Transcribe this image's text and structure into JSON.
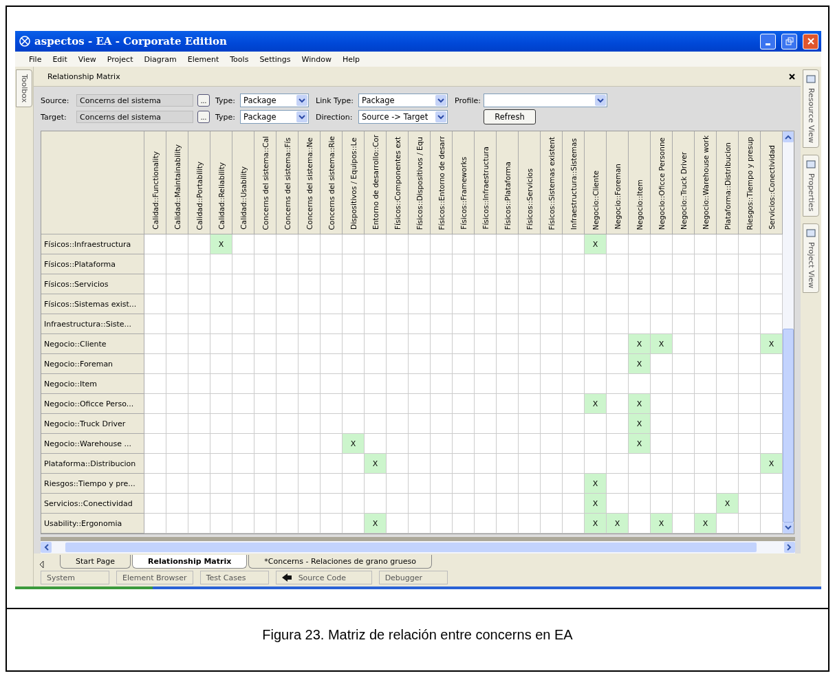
{
  "window": {
    "title": "aspectos - EA - Corporate Edition"
  },
  "menu": [
    "File",
    "Edit",
    "View",
    "Project",
    "Diagram",
    "Element",
    "Tools",
    "Settings",
    "Window",
    "Help"
  ],
  "left_tabs": [
    "Toolbox"
  ],
  "right_tabs": [
    "Resource View",
    "Properties",
    "Project View"
  ],
  "panel": {
    "title": "Relationship Matrix"
  },
  "filters": {
    "source_label": "Source:",
    "source": "Concerns del sistema",
    "target_label": "Target:",
    "target": "Concerns del sistema",
    "browse": "...",
    "source_type_label": "Type:",
    "target_type_label": "Type:",
    "source_type": "Package",
    "target_type": "Package",
    "link_type_label": "Link Type:",
    "link_type": "Package",
    "direction_label": "Direction:",
    "direction": "Source -> Target",
    "profile_label": "Profile:",
    "refresh": "Refresh"
  },
  "matrix": {
    "columns": [
      "Calidad::Functionality",
      "Calidad::Maintainability",
      "Calidad::Portability",
      "Calidad::Reliability",
      "Calidad::Usability",
      "Concerns del sistema::Cal",
      "Concerns del sistema::Fís",
      "Concerns del sistema::Ne",
      "Concerns del sistema::Rie",
      "Dispositivos / Equipos::Le",
      "Entorno de desarrollo::Cor",
      "Físicos::Componentes ext",
      "Físicos::Dispositivos / Equ",
      "Físicos::Entorno de desarr",
      "Físicos::Frameworks",
      "Físicos::Infraestructura",
      "Físicos::Plataforma",
      "Físicos::Servicios",
      "Físicos::Sistemas existent",
      "Infraestructura::Sistemas",
      "Negocio::Cliente",
      "Negocio::Foreman",
      "Negocio::Item",
      "Negocio::Oficce Personne",
      "Negocio::Truck Driver",
      "Negocio::Warehouse work",
      "Plataforma::Distribucion",
      "Riesgos::Tiempo y presup",
      "Servicios::Conectividad"
    ],
    "rows": [
      {
        "label": "Físicos::Infraestructura",
        "cells": [
          {
            "linked": false
          },
          {
            "linked": false
          },
          {
            "linked": false
          },
          {
            "linked": true,
            "mark": "X"
          },
          {
            "linked": false
          },
          {
            "linked": false
          },
          {
            "linked": false
          },
          {
            "linked": false
          },
          {
            "linked": false
          },
          {
            "linked": false
          },
          {
            "linked": false
          },
          {
            "linked": false
          },
          {
            "linked": false
          },
          {
            "linked": false
          },
          {
            "linked": false
          },
          {
            "linked": false
          },
          {
            "linked": false
          },
          {
            "linked": false
          },
          {
            "linked": false
          },
          {
            "linked": false
          },
          {
            "linked": true,
            "mark": "X"
          },
          {
            "linked": false
          },
          {
            "linked": false
          },
          {
            "linked": false
          },
          {
            "linked": false
          },
          {
            "linked": false
          },
          {
            "linked": false
          },
          {
            "linked": false
          },
          {
            "linked": false
          }
        ]
      },
      {
        "label": "Físicos::Plataforma",
        "cells": [
          {
            "linked": false
          },
          {
            "linked": false
          },
          {
            "linked": false
          },
          {
            "linked": false
          },
          {
            "linked": false
          },
          {
            "linked": false
          },
          {
            "linked": false
          },
          {
            "linked": false
          },
          {
            "linked": false
          },
          {
            "linked": false
          },
          {
            "linked": false
          },
          {
            "linked": false
          },
          {
            "linked": false
          },
          {
            "linked": false
          },
          {
            "linked": false
          },
          {
            "linked": false
          },
          {
            "linked": false
          },
          {
            "linked": false
          },
          {
            "linked": false
          },
          {
            "linked": false
          },
          {
            "linked": false
          },
          {
            "linked": false
          },
          {
            "linked": false
          },
          {
            "linked": false
          },
          {
            "linked": false
          },
          {
            "linked": false
          },
          {
            "linked": false
          },
          {
            "linked": false
          },
          {
            "linked": false
          }
        ]
      },
      {
        "label": "Físicos::Servicios",
        "cells": [
          {
            "linked": false
          },
          {
            "linked": false
          },
          {
            "linked": false
          },
          {
            "linked": false
          },
          {
            "linked": false
          },
          {
            "linked": false
          },
          {
            "linked": false
          },
          {
            "linked": false
          },
          {
            "linked": false
          },
          {
            "linked": false
          },
          {
            "linked": false
          },
          {
            "linked": false
          },
          {
            "linked": false
          },
          {
            "linked": false
          },
          {
            "linked": false
          },
          {
            "linked": false
          },
          {
            "linked": false
          },
          {
            "linked": false
          },
          {
            "linked": false
          },
          {
            "linked": false
          },
          {
            "linked": false
          },
          {
            "linked": false
          },
          {
            "linked": false
          },
          {
            "linked": false
          },
          {
            "linked": false
          },
          {
            "linked": false
          },
          {
            "linked": false
          },
          {
            "linked": false
          },
          {
            "linked": false
          }
        ]
      },
      {
        "label": "Físicos::Sistemas exist...",
        "cells": [
          {
            "linked": false
          },
          {
            "linked": false
          },
          {
            "linked": false
          },
          {
            "linked": false
          },
          {
            "linked": false
          },
          {
            "linked": false
          },
          {
            "linked": false
          },
          {
            "linked": false
          },
          {
            "linked": false
          },
          {
            "linked": false
          },
          {
            "linked": false
          },
          {
            "linked": false
          },
          {
            "linked": false
          },
          {
            "linked": false
          },
          {
            "linked": false
          },
          {
            "linked": false
          },
          {
            "linked": false
          },
          {
            "linked": false
          },
          {
            "linked": false
          },
          {
            "linked": false
          },
          {
            "linked": false
          },
          {
            "linked": false
          },
          {
            "linked": false
          },
          {
            "linked": false
          },
          {
            "linked": false
          },
          {
            "linked": false
          },
          {
            "linked": false
          },
          {
            "linked": false
          },
          {
            "linked": false
          }
        ]
      },
      {
        "label": "Infraestructura::Siste...",
        "cells": [
          {
            "linked": false
          },
          {
            "linked": false
          },
          {
            "linked": false
          },
          {
            "linked": false
          },
          {
            "linked": false
          },
          {
            "linked": false
          },
          {
            "linked": false
          },
          {
            "linked": false
          },
          {
            "linked": false
          },
          {
            "linked": false
          },
          {
            "linked": false
          },
          {
            "linked": false
          },
          {
            "linked": false
          },
          {
            "linked": false
          },
          {
            "linked": false
          },
          {
            "linked": false
          },
          {
            "linked": false
          },
          {
            "linked": false
          },
          {
            "linked": false
          },
          {
            "linked": false
          },
          {
            "linked": false
          },
          {
            "linked": false
          },
          {
            "linked": false
          },
          {
            "linked": false
          },
          {
            "linked": false
          },
          {
            "linked": false
          },
          {
            "linked": false
          },
          {
            "linked": false
          },
          {
            "linked": false
          }
        ]
      },
      {
        "label": "Negocio::Cliente",
        "cells": [
          {
            "linked": false
          },
          {
            "linked": false
          },
          {
            "linked": false
          },
          {
            "linked": false
          },
          {
            "linked": false
          },
          {
            "linked": false
          },
          {
            "linked": false
          },
          {
            "linked": false
          },
          {
            "linked": false
          },
          {
            "linked": false
          },
          {
            "linked": false
          },
          {
            "linked": false
          },
          {
            "linked": false
          },
          {
            "linked": false
          },
          {
            "linked": false
          },
          {
            "linked": false
          },
          {
            "linked": false
          },
          {
            "linked": false
          },
          {
            "linked": false
          },
          {
            "linked": false
          },
          {
            "linked": false
          },
          {
            "linked": false
          },
          {
            "linked": true,
            "mark": "X"
          },
          {
            "linked": true,
            "mark": "X"
          },
          {
            "linked": false
          },
          {
            "linked": false
          },
          {
            "linked": false
          },
          {
            "linked": false
          },
          {
            "linked": true,
            "mark": "X"
          }
        ]
      },
      {
        "label": "Negocio::Foreman",
        "cells": [
          {
            "linked": false
          },
          {
            "linked": false
          },
          {
            "linked": false
          },
          {
            "linked": false
          },
          {
            "linked": false
          },
          {
            "linked": false
          },
          {
            "linked": false
          },
          {
            "linked": false
          },
          {
            "linked": false
          },
          {
            "linked": false
          },
          {
            "linked": false
          },
          {
            "linked": false
          },
          {
            "linked": false
          },
          {
            "linked": false
          },
          {
            "linked": false
          },
          {
            "linked": false
          },
          {
            "linked": false
          },
          {
            "linked": false
          },
          {
            "linked": false
          },
          {
            "linked": false
          },
          {
            "linked": false
          },
          {
            "linked": false
          },
          {
            "linked": true,
            "mark": "X"
          },
          {
            "linked": false
          },
          {
            "linked": false
          },
          {
            "linked": false
          },
          {
            "linked": false
          },
          {
            "linked": false
          },
          {
            "linked": false
          }
        ]
      },
      {
        "label": "Negocio::Item",
        "cells": [
          {
            "linked": false
          },
          {
            "linked": false
          },
          {
            "linked": false
          },
          {
            "linked": false
          },
          {
            "linked": false
          },
          {
            "linked": false
          },
          {
            "linked": false
          },
          {
            "linked": false
          },
          {
            "linked": false
          },
          {
            "linked": false
          },
          {
            "linked": false
          },
          {
            "linked": false
          },
          {
            "linked": false
          },
          {
            "linked": false
          },
          {
            "linked": false
          },
          {
            "linked": false
          },
          {
            "linked": false
          },
          {
            "linked": false
          },
          {
            "linked": false
          },
          {
            "linked": false
          },
          {
            "linked": false
          },
          {
            "linked": false
          },
          {
            "linked": false
          },
          {
            "linked": false
          },
          {
            "linked": false
          },
          {
            "linked": false
          },
          {
            "linked": false
          },
          {
            "linked": false
          },
          {
            "linked": false
          }
        ]
      },
      {
        "label": "Negocio::Oficce Perso...",
        "cells": [
          {
            "linked": false
          },
          {
            "linked": false
          },
          {
            "linked": false
          },
          {
            "linked": false
          },
          {
            "linked": false
          },
          {
            "linked": false
          },
          {
            "linked": false
          },
          {
            "linked": false
          },
          {
            "linked": false
          },
          {
            "linked": false
          },
          {
            "linked": false
          },
          {
            "linked": false
          },
          {
            "linked": false
          },
          {
            "linked": false
          },
          {
            "linked": false
          },
          {
            "linked": false
          },
          {
            "linked": false
          },
          {
            "linked": false
          },
          {
            "linked": false
          },
          {
            "linked": false
          },
          {
            "linked": true,
            "mark": "X"
          },
          {
            "linked": false
          },
          {
            "linked": true,
            "mark": "X"
          },
          {
            "linked": false
          },
          {
            "linked": false
          },
          {
            "linked": false
          },
          {
            "linked": false
          },
          {
            "linked": false
          },
          {
            "linked": false
          }
        ]
      },
      {
        "label": "Negocio::Truck Driver",
        "cells": [
          {
            "linked": false
          },
          {
            "linked": false
          },
          {
            "linked": false
          },
          {
            "linked": false
          },
          {
            "linked": false
          },
          {
            "linked": false
          },
          {
            "linked": false
          },
          {
            "linked": false
          },
          {
            "linked": false
          },
          {
            "linked": false
          },
          {
            "linked": false
          },
          {
            "linked": false
          },
          {
            "linked": false
          },
          {
            "linked": false
          },
          {
            "linked": false
          },
          {
            "linked": false
          },
          {
            "linked": false
          },
          {
            "linked": false
          },
          {
            "linked": false
          },
          {
            "linked": false
          },
          {
            "linked": false
          },
          {
            "linked": false
          },
          {
            "linked": true,
            "mark": "X"
          },
          {
            "linked": false
          },
          {
            "linked": false
          },
          {
            "linked": false
          },
          {
            "linked": false
          },
          {
            "linked": false
          },
          {
            "linked": false
          }
        ]
      },
      {
        "label": "Negocio::Warehouse ...",
        "cells": [
          {
            "linked": false
          },
          {
            "linked": false
          },
          {
            "linked": false
          },
          {
            "linked": false
          },
          {
            "linked": false
          },
          {
            "linked": false
          },
          {
            "linked": false
          },
          {
            "linked": false
          },
          {
            "linked": false
          },
          {
            "linked": true,
            "mark": "X"
          },
          {
            "linked": false
          },
          {
            "linked": false
          },
          {
            "linked": false
          },
          {
            "linked": false
          },
          {
            "linked": false
          },
          {
            "linked": false
          },
          {
            "linked": false
          },
          {
            "linked": false
          },
          {
            "linked": false
          },
          {
            "linked": false
          },
          {
            "linked": false
          },
          {
            "linked": false
          },
          {
            "linked": true,
            "mark": "X"
          },
          {
            "linked": false
          },
          {
            "linked": false
          },
          {
            "linked": false
          },
          {
            "linked": false
          },
          {
            "linked": false
          },
          {
            "linked": false
          }
        ]
      },
      {
        "label": "Plataforma::Distribucion",
        "cells": [
          {
            "linked": false
          },
          {
            "linked": false
          },
          {
            "linked": false
          },
          {
            "linked": false
          },
          {
            "linked": false
          },
          {
            "linked": false
          },
          {
            "linked": false
          },
          {
            "linked": false
          },
          {
            "linked": false
          },
          {
            "linked": false
          },
          {
            "linked": true,
            "mark": "X"
          },
          {
            "linked": false
          },
          {
            "linked": false
          },
          {
            "linked": false
          },
          {
            "linked": false
          },
          {
            "linked": false
          },
          {
            "linked": false
          },
          {
            "linked": false
          },
          {
            "linked": false
          },
          {
            "linked": false
          },
          {
            "linked": false
          },
          {
            "linked": false
          },
          {
            "linked": false
          },
          {
            "linked": false
          },
          {
            "linked": false
          },
          {
            "linked": false
          },
          {
            "linked": false
          },
          {
            "linked": false
          },
          {
            "linked": true,
            "mark": "X"
          }
        ]
      },
      {
        "label": "Riesgos::Tiempo y pre...",
        "cells": [
          {
            "linked": false
          },
          {
            "linked": false
          },
          {
            "linked": false
          },
          {
            "linked": false
          },
          {
            "linked": false
          },
          {
            "linked": false
          },
          {
            "linked": false
          },
          {
            "linked": false
          },
          {
            "linked": false
          },
          {
            "linked": false
          },
          {
            "linked": false
          },
          {
            "linked": false
          },
          {
            "linked": false
          },
          {
            "linked": false
          },
          {
            "linked": false
          },
          {
            "linked": false
          },
          {
            "linked": false
          },
          {
            "linked": false
          },
          {
            "linked": false
          },
          {
            "linked": false
          },
          {
            "linked": true,
            "mark": "X"
          },
          {
            "linked": false
          },
          {
            "linked": false
          },
          {
            "linked": false
          },
          {
            "linked": false
          },
          {
            "linked": false
          },
          {
            "linked": false
          },
          {
            "linked": false
          },
          {
            "linked": false
          }
        ]
      },
      {
        "label": "Servicios::Conectividad",
        "cells": [
          {
            "linked": false
          },
          {
            "linked": false
          },
          {
            "linked": false
          },
          {
            "linked": false
          },
          {
            "linked": false
          },
          {
            "linked": false
          },
          {
            "linked": false
          },
          {
            "linked": false
          },
          {
            "linked": false
          },
          {
            "linked": false
          },
          {
            "linked": false
          },
          {
            "linked": false
          },
          {
            "linked": false
          },
          {
            "linked": false
          },
          {
            "linked": false
          },
          {
            "linked": false
          },
          {
            "linked": false
          },
          {
            "linked": false
          },
          {
            "linked": false
          },
          {
            "linked": false
          },
          {
            "linked": true,
            "mark": "X"
          },
          {
            "linked": false
          },
          {
            "linked": false
          },
          {
            "linked": false
          },
          {
            "linked": false
          },
          {
            "linked": false
          },
          {
            "linked": true,
            "mark": "X"
          },
          {
            "linked": false
          },
          {
            "linked": false
          }
        ]
      },
      {
        "label": "Usability::Ergonomia",
        "cells": [
          {
            "linked": false
          },
          {
            "linked": false
          },
          {
            "linked": false
          },
          {
            "linked": false
          },
          {
            "linked": false
          },
          {
            "linked": false
          },
          {
            "linked": false
          },
          {
            "linked": false
          },
          {
            "linked": false
          },
          {
            "linked": false
          },
          {
            "linked": true,
            "mark": "X"
          },
          {
            "linked": false
          },
          {
            "linked": false
          },
          {
            "linked": false
          },
          {
            "linked": false
          },
          {
            "linked": false
          },
          {
            "linked": false
          },
          {
            "linked": false
          },
          {
            "linked": false
          },
          {
            "linked": false
          },
          {
            "linked": true,
            "mark": "X"
          },
          {
            "linked": true,
            "mark": "X"
          },
          {
            "linked": false
          },
          {
            "linked": true,
            "mark": "X"
          },
          {
            "linked": false
          },
          {
            "linked": true,
            "mark": "X"
          },
          {
            "linked": false
          },
          {
            "linked": false
          },
          {
            "linked": false
          }
        ]
      }
    ]
  },
  "doc_tabs": [
    {
      "label": "Start Page",
      "selected": false
    },
    {
      "label": "Relationship Matrix",
      "selected": true
    },
    {
      "label": "*Concerns - Relaciones de grano grueso",
      "selected": false
    }
  ],
  "bottom_buttons": [
    {
      "label": "System",
      "kind": "plain"
    },
    {
      "label": "Element Browser",
      "kind": "plain"
    },
    {
      "label": "Test Cases",
      "kind": "plain"
    },
    {
      "label": "Source Code",
      "kind": "icon"
    },
    {
      "label": "Debugger",
      "kind": "plain"
    }
  ],
  "caption": "Figura 23. Matriz de relación entre concerns en EA"
}
